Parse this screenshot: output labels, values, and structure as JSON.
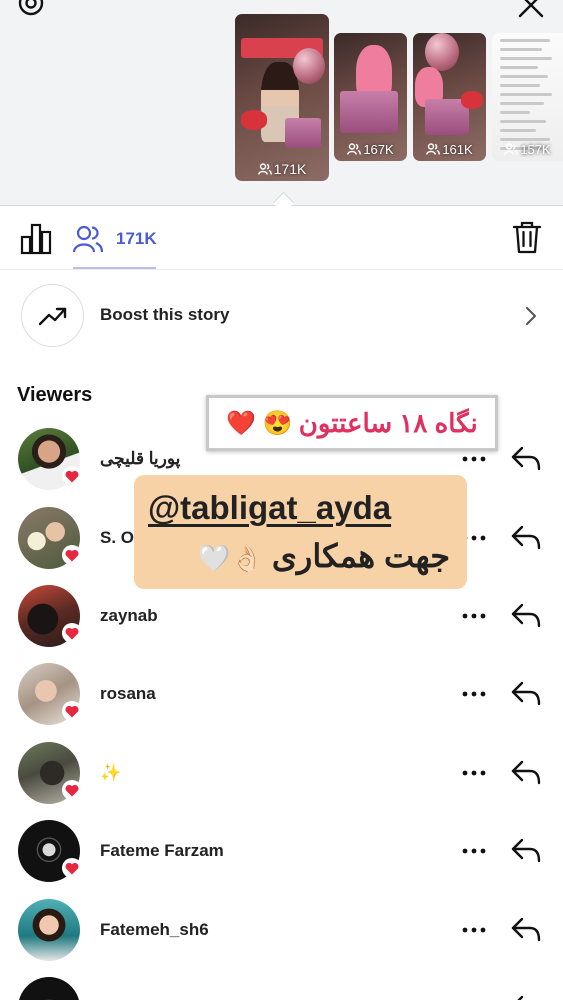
{
  "stories": [
    {
      "count": "171K",
      "selected": true
    },
    {
      "count": "167K",
      "selected": false
    },
    {
      "count": "161K",
      "selected": false
    },
    {
      "count": "157K",
      "selected": false
    }
  ],
  "tabs": {
    "viewer_count": "171K"
  },
  "boost": {
    "label": "Boost this story"
  },
  "viewers": {
    "title": "Viewers",
    "list": [
      {
        "name": "پوریا قلیچی",
        "liked": true
      },
      {
        "name": "S. O",
        "liked": true
      },
      {
        "name": "zaynab",
        "liked": true
      },
      {
        "name": "rosana",
        "liked": true
      },
      {
        "name": "✨",
        "liked": true
      },
      {
        "name": "Fateme Farzam",
        "liked": true
      },
      {
        "name": "Fatemeh_sh6",
        "liked": false
      },
      {
        "name": "",
        "liked": false
      }
    ]
  },
  "overlay": {
    "views_text": "نگاه ۱۸ ساعتتون",
    "views_emoji": "❤️ 😍",
    "handle": "@tabligat_ayda",
    "cooperation_text": "جهت همکاری",
    "cooperation_emoji": "👌🏻🤍"
  },
  "colors": {
    "accent": "#4a5bd6",
    "heart": "#e8263f",
    "overlay_pink": "#e0305f",
    "overlay_peach": "#f8d2a7"
  }
}
